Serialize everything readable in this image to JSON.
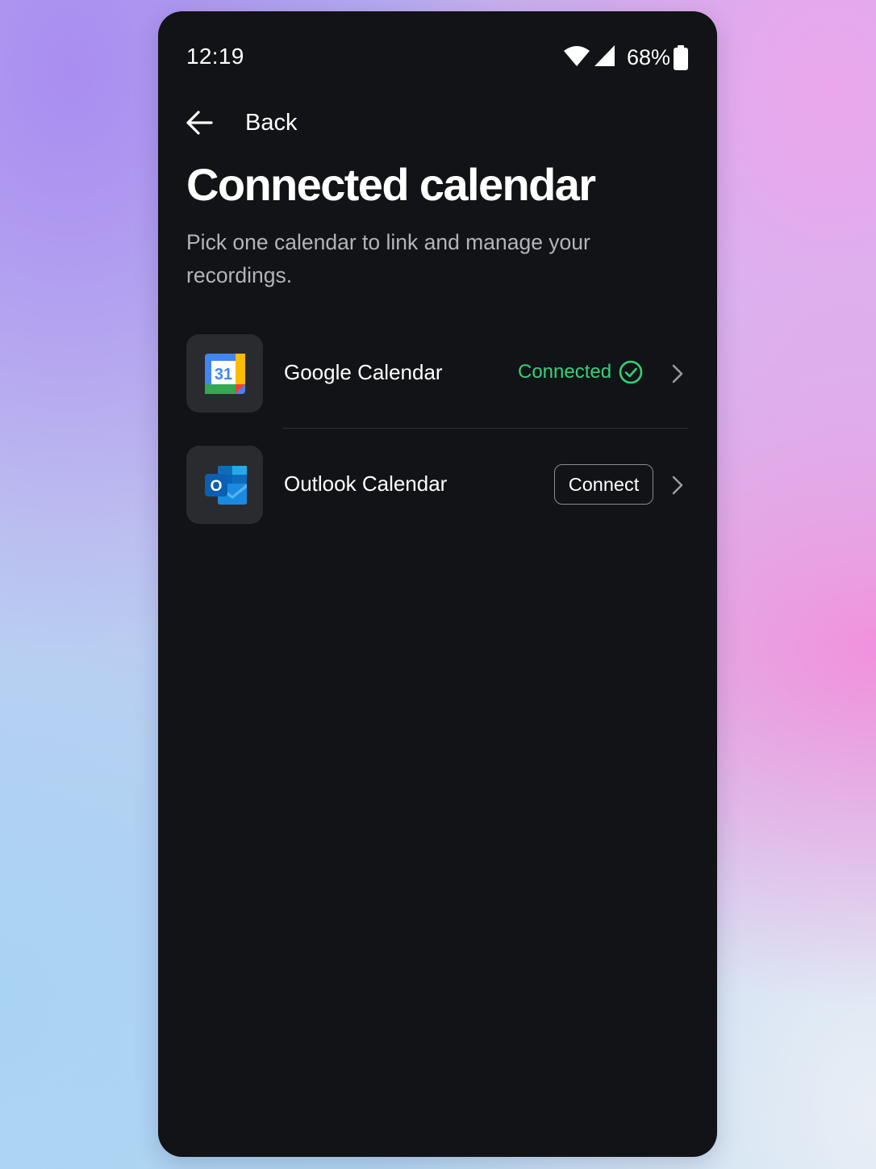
{
  "status_bar": {
    "time": "12:19",
    "battery_percent": "68%",
    "icons": [
      "wifi-icon",
      "cell-signal-icon",
      "battery-icon"
    ]
  },
  "nav": {
    "back_label": "Back",
    "icon": "arrow-left-icon"
  },
  "header": {
    "title": "Connected calendar",
    "subtitle": "Pick one calendar to link and manage your recordings."
  },
  "calendars": [
    {
      "name": "Google Calendar",
      "icon": "google-calendar-icon",
      "icon_text": "31",
      "status": "Connected",
      "status_color": "#34d17a",
      "status_icon": "check-circle-icon"
    },
    {
      "name": "Outlook Calendar",
      "icon": "outlook-icon",
      "icon_text": "O",
      "action_label": "Connect"
    }
  ],
  "colors": {
    "background": "#121316",
    "tile": "#2a2b2f",
    "connected": "#34d17a"
  }
}
